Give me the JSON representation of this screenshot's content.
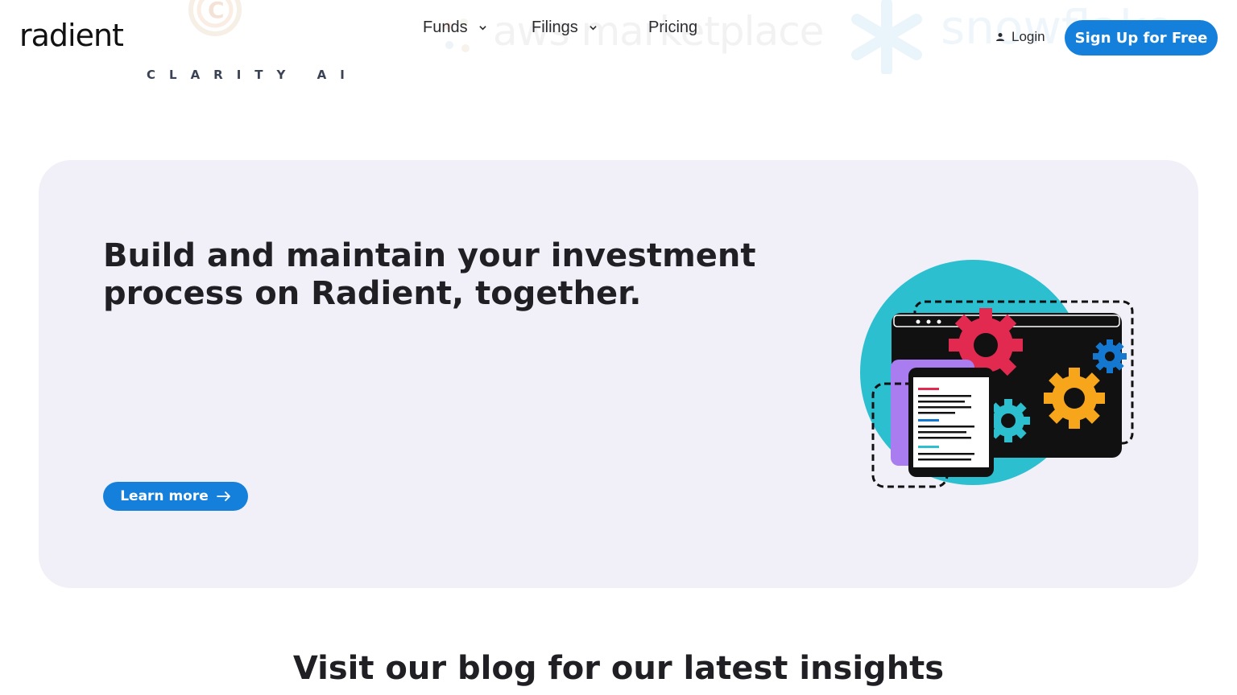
{
  "partners": {
    "clarity_text": "CLARITY AI",
    "aws_text": "aws marketplace",
    "snowflake_text": "snowflake"
  },
  "header": {
    "logo": "radient",
    "nav": [
      {
        "label": "Funds",
        "has_dropdown": true
      },
      {
        "label": "Filings",
        "has_dropdown": true
      },
      {
        "label": "Pricing",
        "has_dropdown": false
      }
    ],
    "login_label": "Login",
    "signup_label": "Sign Up for Free"
  },
  "hero": {
    "title": "Build and maintain your investment process on Radient, together.",
    "cta_label": "Learn more"
  },
  "blog": {
    "title": "Visit our blog for our latest insights"
  },
  "colors": {
    "brand_blue": "#1480dc",
    "card_bg": "#f1f0f8",
    "teal": "#2bbfcf",
    "red_gear": "#e2294f",
    "orange_gear": "#f7a51b",
    "purple": "#a97cf0"
  }
}
